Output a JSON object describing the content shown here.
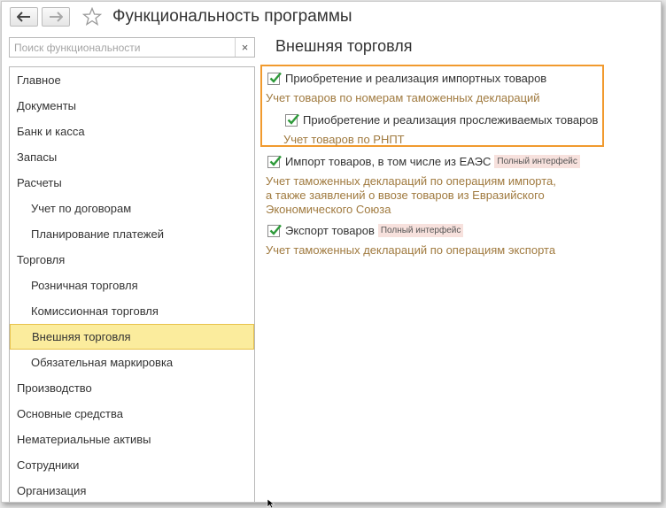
{
  "window": {
    "title": "Функциональность программы"
  },
  "search": {
    "placeholder": "Поиск функциональности",
    "clear_label": "×"
  },
  "sidebar": {
    "items": [
      {
        "label": "Главное",
        "level": 1,
        "active": false
      },
      {
        "label": "Документы",
        "level": 1,
        "active": false
      },
      {
        "label": "Банк и касса",
        "level": 1,
        "active": false
      },
      {
        "label": "Запасы",
        "level": 1,
        "active": false
      },
      {
        "label": "Расчеты",
        "level": 1,
        "active": false
      },
      {
        "label": "Учет по договорам",
        "level": 2,
        "active": false
      },
      {
        "label": "Планирование платежей",
        "level": 2,
        "active": false
      },
      {
        "label": "Торговля",
        "level": 1,
        "active": false
      },
      {
        "label": "Розничная торговля",
        "level": 2,
        "active": false
      },
      {
        "label": "Комиссионная торговля",
        "level": 2,
        "active": false
      },
      {
        "label": "Внешняя торговля",
        "level": 2,
        "active": true
      },
      {
        "label": "Обязательная маркировка",
        "level": 2,
        "active": false
      },
      {
        "label": "Производство",
        "level": 1,
        "active": false
      },
      {
        "label": "Основные средства",
        "level": 1,
        "active": false
      },
      {
        "label": "Нематериальные активы",
        "level": 1,
        "active": false
      },
      {
        "label": "Сотрудники",
        "level": 1,
        "active": false
      },
      {
        "label": "Организация",
        "level": 1,
        "active": false
      }
    ]
  },
  "main": {
    "section_title": "Внешняя торговля",
    "options": {
      "import_goods": {
        "label": "Приобретение и реализация импортных товаров",
        "checked": true,
        "description": "Учет товаров по номерам таможенных деклараций"
      },
      "traceable_goods": {
        "label": "Приобретение и реализация прослеживаемых товаров",
        "checked": true,
        "description": "Учет товаров по РНПТ"
      },
      "eaeu_import": {
        "label": "Импорт товаров, в том числе из ЕАЭС",
        "checked": true,
        "badge": "Полный интерфейс",
        "description_lines": [
          "Учет таможенных деклараций по операциям импорта,",
          "а также заявлений о ввозе товаров из Евразийского",
          "Экономического Союза"
        ]
      },
      "export_goods": {
        "label": "Экспорт товаров",
        "checked": true,
        "badge": "Полный интерфейс",
        "description": "Учет таможенных деклараций по операциям экспорта"
      }
    }
  },
  "colors": {
    "active_item_bg": "#fbec9d",
    "highlight_border": "#f19a2e",
    "description_text": "#a07a3f",
    "checkmark": "#2e9a3a",
    "badge_bg": "#f7e1dd"
  }
}
